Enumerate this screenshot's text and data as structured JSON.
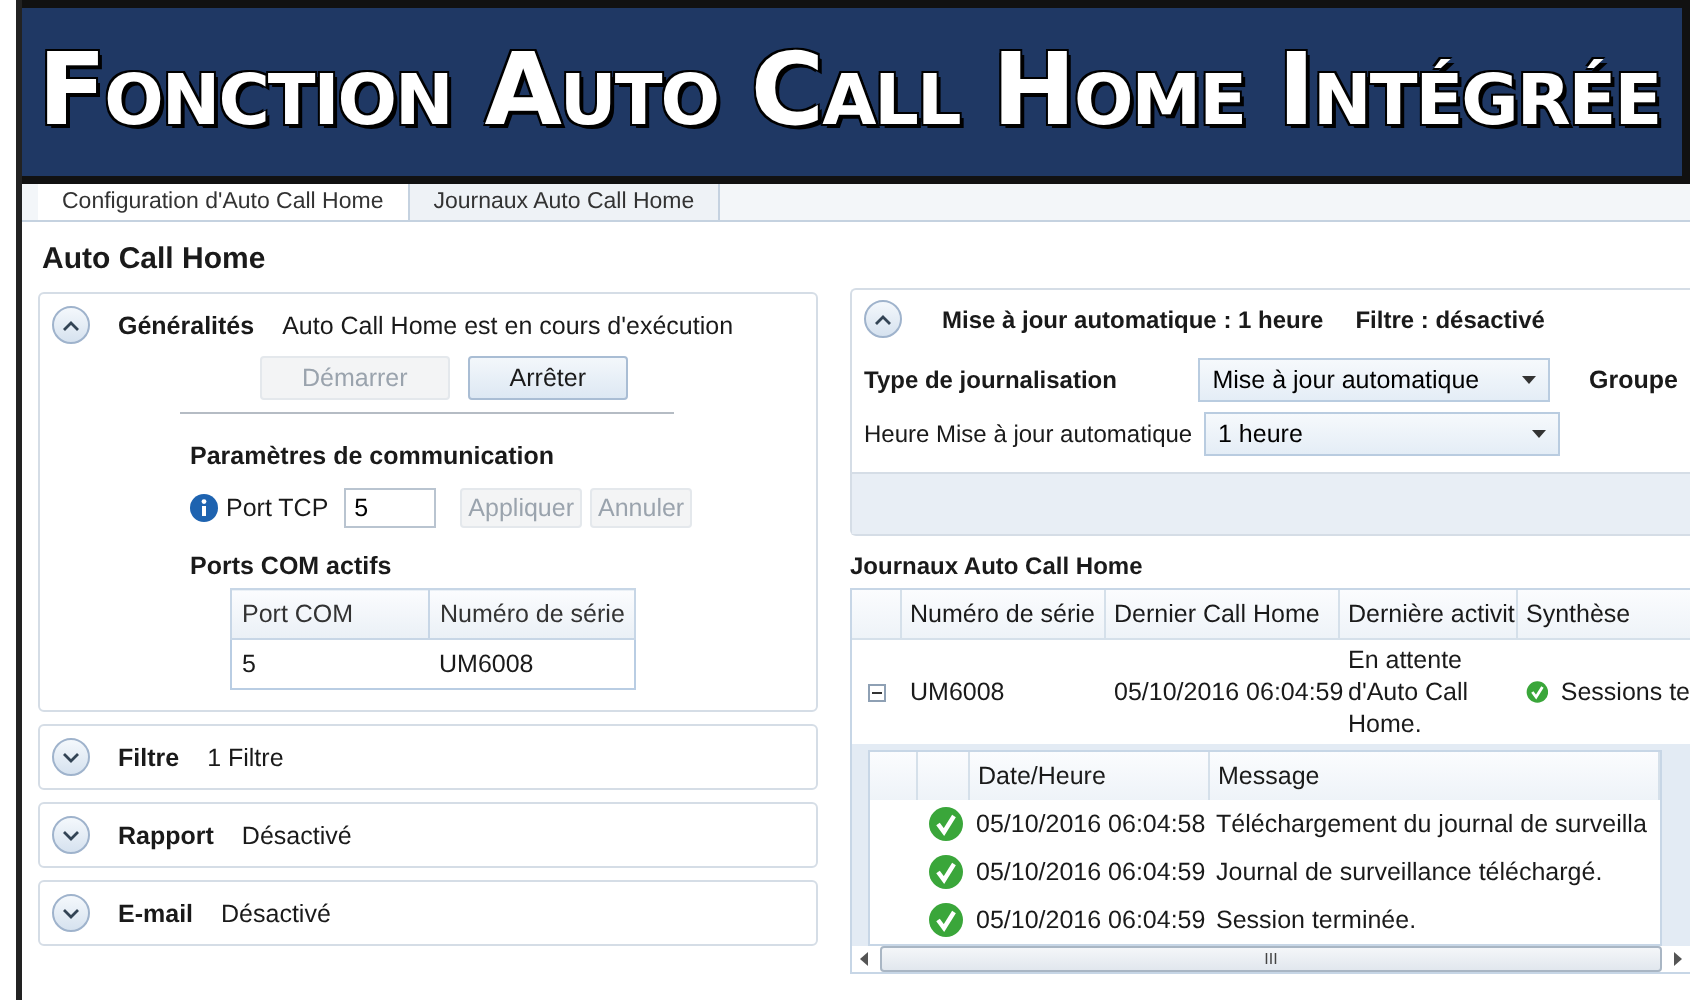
{
  "banner": {
    "title": "Fonction Auto Call Home Intégrée"
  },
  "tabs": [
    {
      "label": "Configuration d'Auto Call Home",
      "selected": true
    },
    {
      "label": "Journaux Auto Call Home",
      "selected": false
    }
  ],
  "page_title": "Auto Call Home",
  "sections": [
    {
      "title": "Généralités",
      "summary": "Auto Call Home est en cours d'exécution",
      "expanded": true,
      "buttons": [
        {
          "label": "Démarrer",
          "disabled": true
        },
        {
          "label": "Arrêter",
          "disabled": false
        }
      ],
      "comm_title": "Paramètres de communication",
      "port_label": "Port TCP",
      "port_value": "5",
      "port_buttons": [
        {
          "label": "Appliquer",
          "disabled": true
        },
        {
          "label": "Annuler",
          "disabled": true
        }
      ],
      "com_title": "Ports COM actifs",
      "com_columns": [
        "Port COM",
        "Numéro de série"
      ],
      "com_rows": [
        [
          "5",
          "UM6008"
        ]
      ]
    },
    {
      "title": "Filtre",
      "summary": "1 Filtre",
      "expanded": false
    },
    {
      "title": "Rapport",
      "summary": "Désactivé",
      "expanded": false
    },
    {
      "title": "E-mail",
      "summary": "Désactivé",
      "expanded": false
    }
  ],
  "update_panel": {
    "expanded": true,
    "header": [
      "Mise à jour automatique : 1 heure",
      "Filtre : désactivé"
    ],
    "fields": [
      {
        "label": "Type de journalisation",
        "bold": true,
        "value": "Mise à jour automatique"
      },
      {
        "label": "Heure Mise à jour automatique",
        "bold": false,
        "value": "1 heure"
      }
    ],
    "side_label": "Groupe"
  },
  "logs": {
    "title": "Journaux Auto Call Home",
    "columns": [
      "Numéro de série",
      "Dernier Call Home",
      "Dernière activit",
      "Synthèse"
    ],
    "rows": [
      {
        "expanded": true,
        "serial": "UM6008",
        "last_call": "05/10/2016 06:04:59",
        "activity": "En attente d'Auto Call Home.",
        "summary": "Sessions te"
      }
    ],
    "detail_columns": [
      "Date/Heure",
      "Message"
    ],
    "detail_rows": [
      {
        "datetime": "05/10/2016 06:04:58",
        "message": "Téléchargement du journal de surveilla"
      },
      {
        "datetime": "05/10/2016 06:04:59",
        "message": "Journal de surveillance téléchargé."
      },
      {
        "datetime": "05/10/2016 06:04:59",
        "message": "Session terminée."
      }
    ],
    "scroll_grip": "III"
  }
}
